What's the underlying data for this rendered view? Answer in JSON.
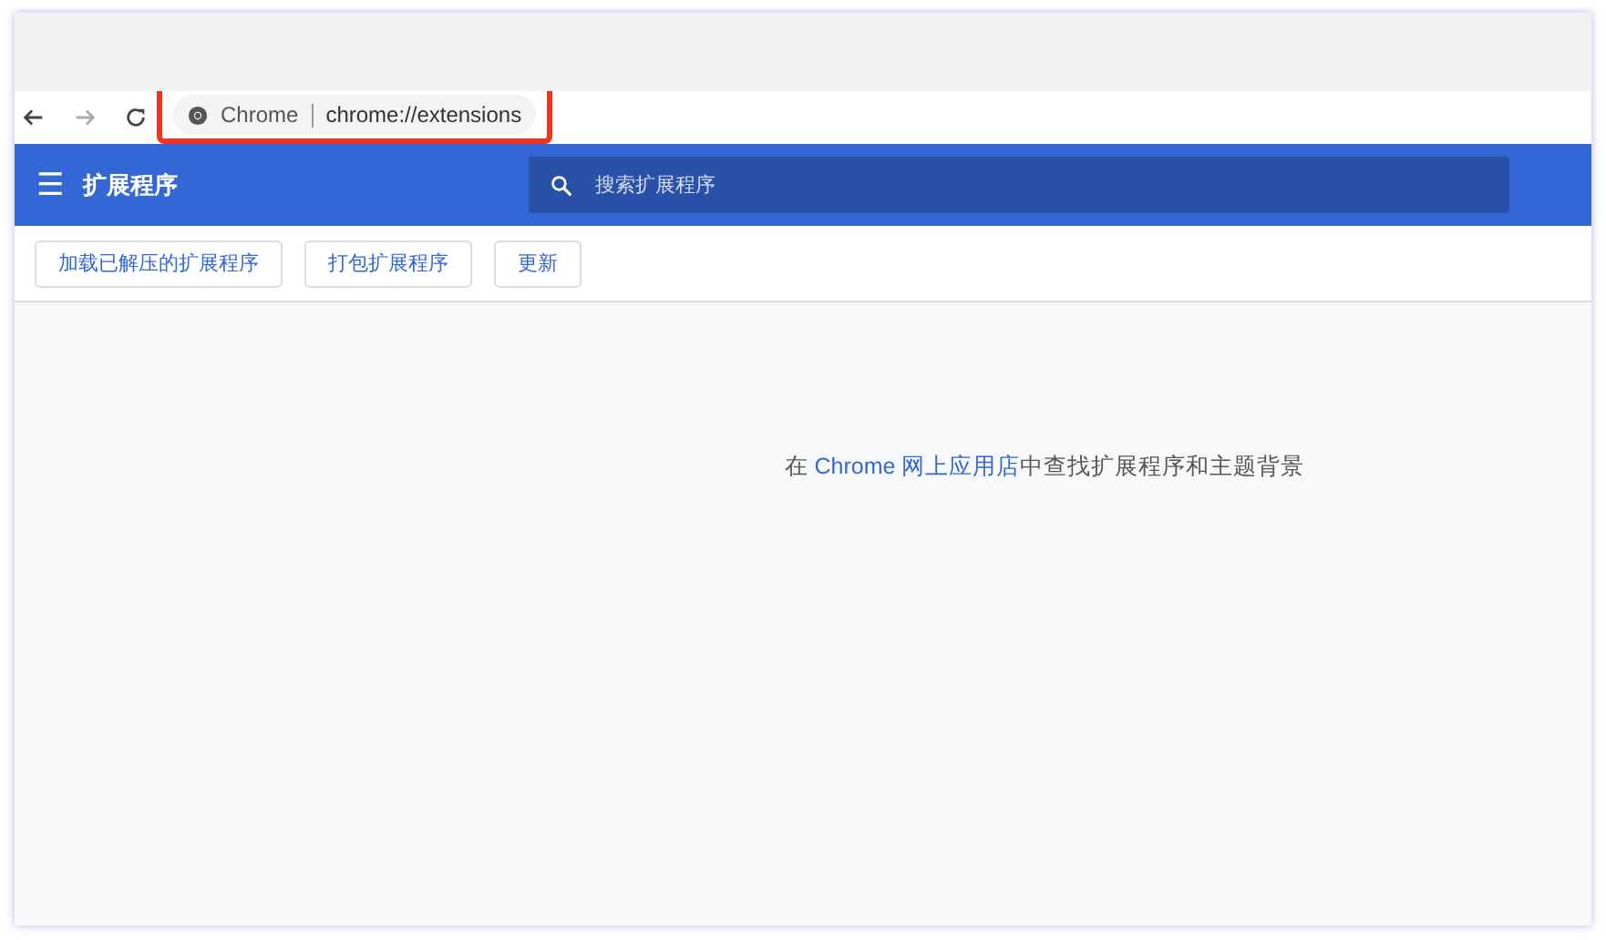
{
  "toolbar": {
    "origin_label": "Chrome",
    "url": "chrome://extensions",
    "highlighted": true
  },
  "header": {
    "menu_icon": "☰",
    "title": "扩展程序",
    "search": {
      "placeholder": "搜索扩展程序"
    }
  },
  "actions": [
    "加载已解压的扩展程序",
    "打包扩展程序",
    "更新"
  ],
  "empty_message": {
    "before": "在 ",
    "link": "Chrome 网上应用店",
    "after": "中查找扩展程序和主题背景"
  }
}
